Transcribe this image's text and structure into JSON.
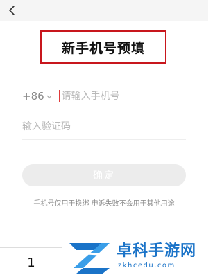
{
  "header": {
    "title": "新手机号预填"
  },
  "form": {
    "country_code": "+86",
    "phone_placeholder": "请输入手机号",
    "code_placeholder": "输入验证码",
    "confirm_label": "确定",
    "hint": "手机号仅用于换绑 申诉失败不会用于其他用途"
  },
  "keyboard": {
    "key": "1"
  },
  "watermark": {
    "name": "卓科手游网",
    "url": "zkhcedu.com"
  },
  "icons": {
    "back": "chevron-left-icon",
    "country_dropdown": "chevron-down-icon",
    "watermark_logo": "z-logo-icon"
  },
  "colors": {
    "highlight_border": "#c8161d",
    "input_cursor": "#e03a3a",
    "button_disabled": "#ececec",
    "watermark_blue": "#1a73c8"
  }
}
